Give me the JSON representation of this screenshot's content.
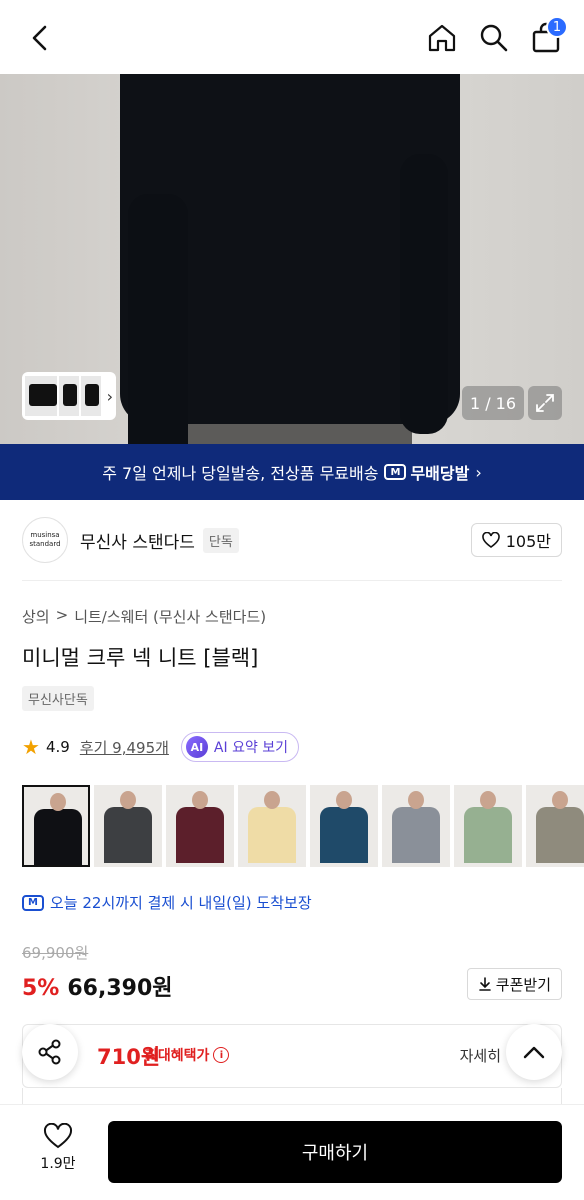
{
  "topbar": {
    "cart_count": "1"
  },
  "gallery": {
    "counter": "1 / 16"
  },
  "shipping_banner": {
    "text": "주 7일 언제나 당일발송, 전상품 무료배송",
    "brand": "무배당발",
    "brand_mark": "M"
  },
  "brand": {
    "logo_line1": "musinsa",
    "logo_line2": "standard",
    "name": "무신사 스탠다드",
    "tag": "단독",
    "likes": "105만"
  },
  "breadcrumb": {
    "items": [
      "상의",
      "니트/스웨터 (무신사 스탠다드)"
    ],
    "separator": ">"
  },
  "product": {
    "title": "미니멀 크루 넥 니트 [블랙]",
    "exclusive_tag": "무신사단독"
  },
  "rating": {
    "score": "4.9",
    "review_text": "후기 9,495개",
    "ai_icon": "AI",
    "ai_label": "AI 요약 보기"
  },
  "swatches": [
    {
      "color": "#0f1014",
      "selected": true
    },
    {
      "color": "#3d3f42",
      "selected": false
    },
    {
      "color": "#5c1f2b",
      "selected": false
    },
    {
      "color": "#efdca6",
      "selected": false
    },
    {
      "color": "#1f4a69",
      "selected": false
    },
    {
      "color": "#8a9099",
      "selected": false
    },
    {
      "color": "#96b091",
      "selected": false
    },
    {
      "color": "#8f8b7d",
      "selected": false
    }
  ],
  "delivery": {
    "text": "오늘 22시까지 결제 시 내일(일) 도착보장",
    "mark": "M"
  },
  "price": {
    "original": "69,900원",
    "discount": "5%",
    "current": "66,390원",
    "coupon_label": "쿠폰받기"
  },
  "benefit": {
    "price": "710원",
    "label": "최대혜택가",
    "info_icon": "i",
    "detail": "자세히"
  },
  "bottom": {
    "wish_count": "1.9만",
    "buy_label": "구매하기"
  },
  "colors": {
    "brand_blue": "#0f2a7a",
    "accent_red": "#e02020",
    "link_blue": "#1a4fd1",
    "ai_purple": "#5a3fd6",
    "badge_blue": "#2b6bff"
  }
}
